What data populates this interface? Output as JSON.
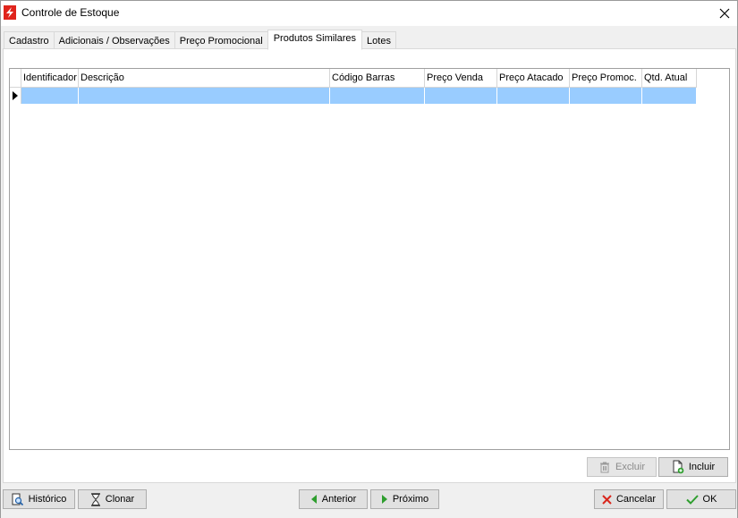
{
  "window": {
    "title": "Controle de Estoque"
  },
  "tabs": [
    {
      "label": "Cadastro"
    },
    {
      "label": "Adicionais / Observações"
    },
    {
      "label": "Preço Promocional"
    },
    {
      "label": "Produtos Similares",
      "active": true
    },
    {
      "label": "Lotes"
    }
  ],
  "grid": {
    "columns": [
      "Identificador",
      "Descrição",
      "Código Barras",
      "Preço Venda",
      "Preço Atacado",
      "Preço Promoc.",
      "Qtd. Atual"
    ],
    "rows": [
      [
        "",
        "",
        "",
        "",
        "",
        "",
        ""
      ]
    ],
    "selection_color": "#99ccff"
  },
  "panel_buttons": {
    "excluir": "Excluir",
    "incluir": "Incluir"
  },
  "footer_buttons": {
    "historico": "Histórico",
    "clonar": "Clonar",
    "anterior": "Anterior",
    "proximo": "Próximo",
    "cancelar": "Cancelar",
    "ok": "OK"
  },
  "colors": {
    "brand_red": "#e0241c",
    "arrow_green": "#2e9e2e",
    "cancel_red": "#d9261c"
  }
}
